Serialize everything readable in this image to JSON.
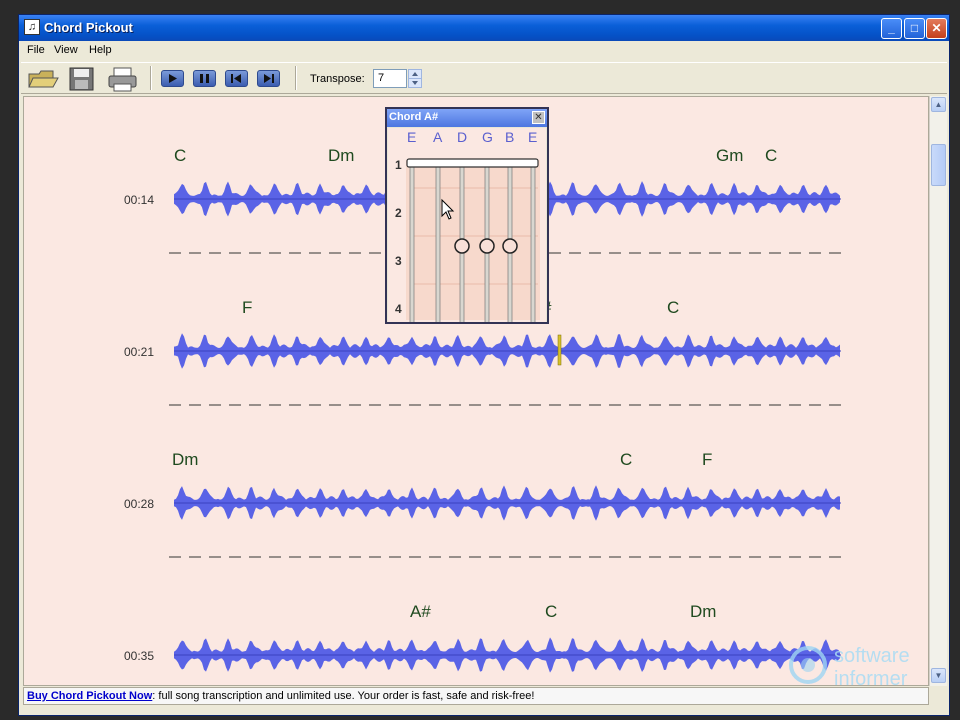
{
  "window": {
    "title": "Chord Pickout",
    "app_icon_glyph": "♫"
  },
  "menu": [
    "File",
    "View",
    "Help"
  ],
  "toolbar": {
    "buttons": [
      "open-icon",
      "save-icon",
      "print-icon",
      "play-icon",
      "pause-icon",
      "previous-icon",
      "next-icon"
    ],
    "transpose_label": "Transpose:",
    "transpose_value": "7"
  },
  "rows": [
    {
      "time": "00:14",
      "chords": [
        "C",
        "Dm",
        "Gm",
        "C"
      ]
    },
    {
      "time": "00:21",
      "chords": [
        "F",
        "#",
        "C"
      ]
    },
    {
      "time": "00:28",
      "chords": [
        "Dm",
        "C",
        "F"
      ]
    },
    {
      "time": "00:35",
      "chords": [
        "A#",
        "C",
        "Dm"
      ]
    }
  ],
  "chord_popup": {
    "title": "Chord A#",
    "strings": [
      "E",
      "A",
      "D",
      "G",
      "B",
      "E"
    ],
    "frets": [
      "1",
      "2",
      "3",
      "4"
    ]
  },
  "statusbar": {
    "link_text": "Buy Chord Pickout Now",
    "message": ": full song transcription and unlimited use. Your order is fast, safe and risk-free!"
  },
  "watermark": {
    "line1": "software",
    "line2": "informer"
  },
  "colors": {
    "wave": "#5a63e6",
    "chord_text": "#1f4a1f",
    "background": "#fbe8e2"
  }
}
